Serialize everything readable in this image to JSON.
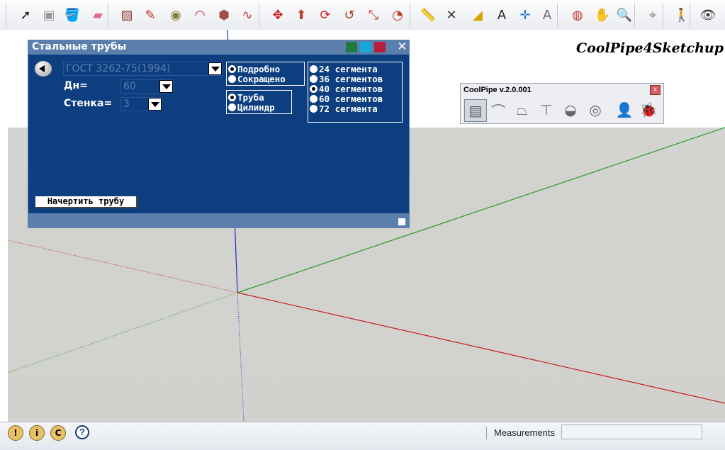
{
  "toolbar": {
    "tools": [
      {
        "name": "select-icon",
        "glyph": "➚",
        "color": "#111"
      },
      {
        "name": "component-icon",
        "glyph": "▣",
        "color": "#999"
      },
      {
        "name": "paint-bucket-icon",
        "glyph": "🪣",
        "color": "#d9a000"
      },
      {
        "name": "eraser-icon",
        "glyph": "▰",
        "color": "#e06c8a"
      },
      {
        "name": "rectangle-icon",
        "glyph": "▨",
        "color": "#8b3b2b"
      },
      {
        "name": "pencil-icon",
        "glyph": "✎",
        "color": "#c0392b"
      },
      {
        "name": "circle-icon",
        "glyph": "◉",
        "color": "#8a7a3a"
      },
      {
        "name": "arc-icon",
        "glyph": "◠",
        "color": "#c0392b"
      },
      {
        "name": "polygon-icon",
        "glyph": "⬢",
        "color": "#a0504a"
      },
      {
        "name": "freehand-icon",
        "glyph": "∿",
        "color": "#c0392b"
      },
      {
        "name": "move-icon",
        "glyph": "✥",
        "color": "#d32020"
      },
      {
        "name": "push-pull-icon",
        "glyph": "⬆",
        "color": "#c0392b"
      },
      {
        "name": "rotate-icon",
        "glyph": "⟳",
        "color": "#d32020"
      },
      {
        "name": "follow-me-icon",
        "glyph": "↺",
        "color": "#a04020"
      },
      {
        "name": "scale-icon",
        "glyph": "⤡",
        "color": "#c0392b"
      },
      {
        "name": "offset-icon",
        "glyph": "◔",
        "color": "#c0392b"
      },
      {
        "name": "tape-measure-icon",
        "glyph": "📏",
        "color": "#c79a12"
      },
      {
        "name": "dimension-icon",
        "glyph": "✕",
        "color": "#333"
      },
      {
        "name": "protractor-icon",
        "glyph": "◢",
        "color": "#d9a000"
      },
      {
        "name": "text-icon",
        "glyph": "A",
        "color": "#222"
      },
      {
        "name": "axes-icon",
        "glyph": "✛",
        "color": "#1a6fd1"
      },
      {
        "name": "3d-text-icon",
        "glyph": "A",
        "color": "#666"
      },
      {
        "name": "orbit-icon",
        "glyph": "◍",
        "color": "#c0392b"
      },
      {
        "name": "pan-icon",
        "glyph": "✋",
        "color": "#333"
      },
      {
        "name": "zoom-icon",
        "glyph": "🔍",
        "color": "#222"
      },
      {
        "name": "position-camera-icon",
        "glyph": "⌖",
        "color": "#888"
      },
      {
        "name": "walk-icon",
        "glyph": "🚶",
        "color": "#333"
      },
      {
        "name": "look-around-icon",
        "glyph": "👁",
        "color": "#333"
      }
    ]
  },
  "brand": "CoolPipe4Sketchup",
  "dialog": {
    "title": "Стальные трубы",
    "colors": {
      "green": "#1f7a3f",
      "cyan": "#17a8d8",
      "red": "#b81e3a"
    },
    "standard": "ГОСТ 3262-75(1994)",
    "dn_label": "Дн=",
    "dn_value": "60",
    "wall_label": "Стенка=",
    "wall_value": "3",
    "detail": {
      "options": [
        "Подробно",
        "Сокращено"
      ],
      "selected": 0
    },
    "shape": {
      "options": [
        "Труба",
        "Цилиндр"
      ],
      "selected": 0
    },
    "segments": {
      "options": [
        "24 сегмента",
        "36 сегментов",
        "40 сегментов",
        "60 сегментов",
        "72 сегмента"
      ],
      "selected": 2
    },
    "draw_button": "Начертить трубу"
  },
  "coolpipe": {
    "title": "CoolPipe v.2.0.001",
    "close": "x",
    "icons": [
      {
        "name": "pipe-icon",
        "glyph": "▤",
        "color": "#555"
      },
      {
        "name": "elbow-icon",
        "glyph": "⌒",
        "color": "#777"
      },
      {
        "name": "reducer-icon",
        "glyph": "⏢",
        "color": "#777"
      },
      {
        "name": "tee-icon",
        "glyph": "⊤",
        "color": "#777"
      },
      {
        "name": "cap-icon",
        "glyph": "◒",
        "color": "#666"
      },
      {
        "name": "flange-icon",
        "glyph": "◎",
        "color": "#666"
      },
      {
        "name": "user-remove-icon",
        "glyph": "👤",
        "color": "#333"
      },
      {
        "name": "bug-icon",
        "glyph": "🐞",
        "color": "#222"
      }
    ]
  },
  "status": {
    "icons": [
      {
        "name": "geolocation-icon",
        "glyph": "!"
      },
      {
        "name": "credits-icon",
        "glyph": "i"
      },
      {
        "name": "copyright-icon",
        "glyph": "C"
      }
    ],
    "help": "?",
    "measurements_label": "Measurements",
    "measurements_value": ""
  }
}
